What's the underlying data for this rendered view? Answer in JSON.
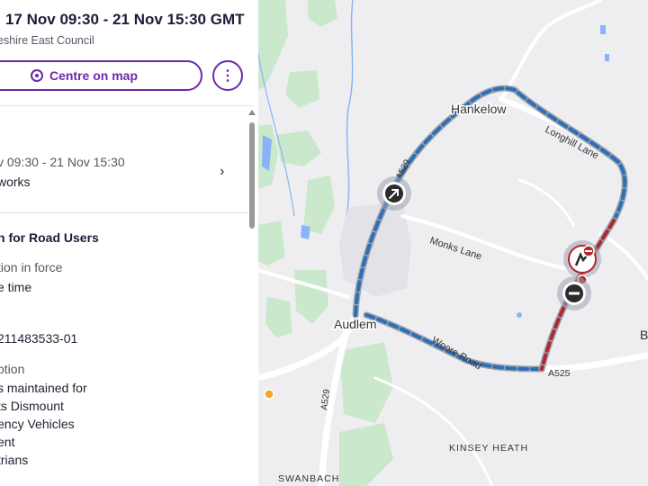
{
  "header": {
    "dates": "17 Nov 09:30 - 21 Nov 15:30 GMT",
    "authority": "eshire East Council",
    "centre_button": "Centre on map",
    "more_button": "⋮"
  },
  "period": {
    "dates": "v 09:30 - 21 Nov 15:30",
    "type": "works"
  },
  "info": {
    "heading": "n for Road Users",
    "restriction_label": "tion in force",
    "restriction_value": "e time",
    "reference": "211483533-01",
    "description_label": "ption",
    "description_lines": [
      "s maintained for",
      "ts Dismount",
      "ency Vehicles",
      "ent",
      "trians"
    ]
  },
  "map": {
    "labels": {
      "hankelow": "Hankelow",
      "audlem": "Audlem",
      "kinsey_heath": "KINSEY HEATH",
      "swanbach": "SWANBACH",
      "longhill_lane": "Longhill Lane",
      "monks_lane": "Monks Lane",
      "woore_road": "Woore Road",
      "a529_north": "A529",
      "a529_south": "A529",
      "a525": "A525",
      "edge_b": "B"
    },
    "colors": {
      "diversion": "#2d6fb4",
      "closure": "#b2262f",
      "water": "#8ab4f8",
      "green": "#c9e8cc"
    }
  }
}
